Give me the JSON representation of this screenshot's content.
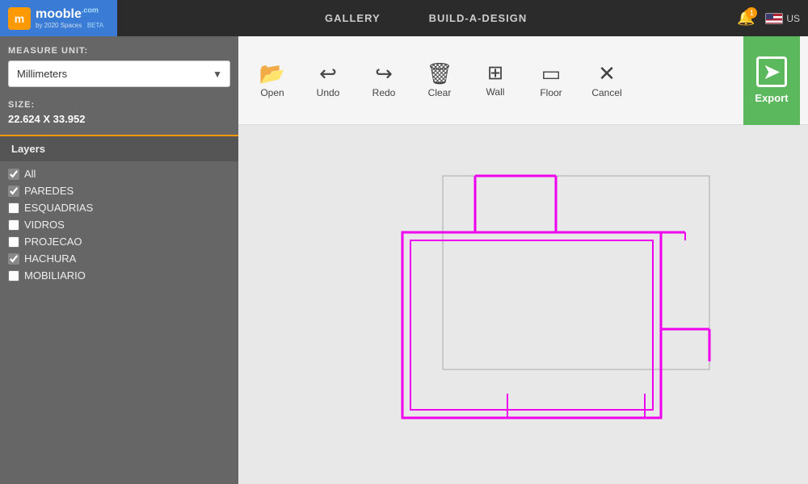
{
  "nav": {
    "gallery_label": "GALLERY",
    "build_label": "BUILD-A-DESIGN",
    "logo_text": "mooble",
    "logo_com": ".com",
    "logo_sub": "by 2020 Spaces",
    "logo_beta": "BETA",
    "notif_count": "1",
    "region_label": "US"
  },
  "left_panel": {
    "measure_label": "MEASURE UNIT:",
    "measure_value": "Millimeters",
    "size_label": "SIZE:",
    "size_value": "22.624 X 33.952",
    "layers_header": "Layers",
    "layers": [
      {
        "name": "All",
        "checked": true
      },
      {
        "name": "PAREDES",
        "checked": true
      },
      {
        "name": "ESQUADRIAS",
        "checked": false
      },
      {
        "name": "VIDROS",
        "checked": false
      },
      {
        "name": "PROJECAO",
        "checked": false
      },
      {
        "name": "HACHURA",
        "checked": true
      },
      {
        "name": "MOBILIARIO",
        "checked": false
      }
    ]
  },
  "toolbar": {
    "open_label": "Open",
    "undo_label": "Undo",
    "redo_label": "Redo",
    "clear_label": "Clear",
    "wall_label": "Wall",
    "floor_label": "Floor",
    "cancel_label": "Cancel",
    "export_label": "Export"
  },
  "colors": {
    "accent_orange": "#f90",
    "export_green": "#5cb85c",
    "floor_plan_magenta": "#e0e",
    "floor_plan_gray": "#888"
  }
}
